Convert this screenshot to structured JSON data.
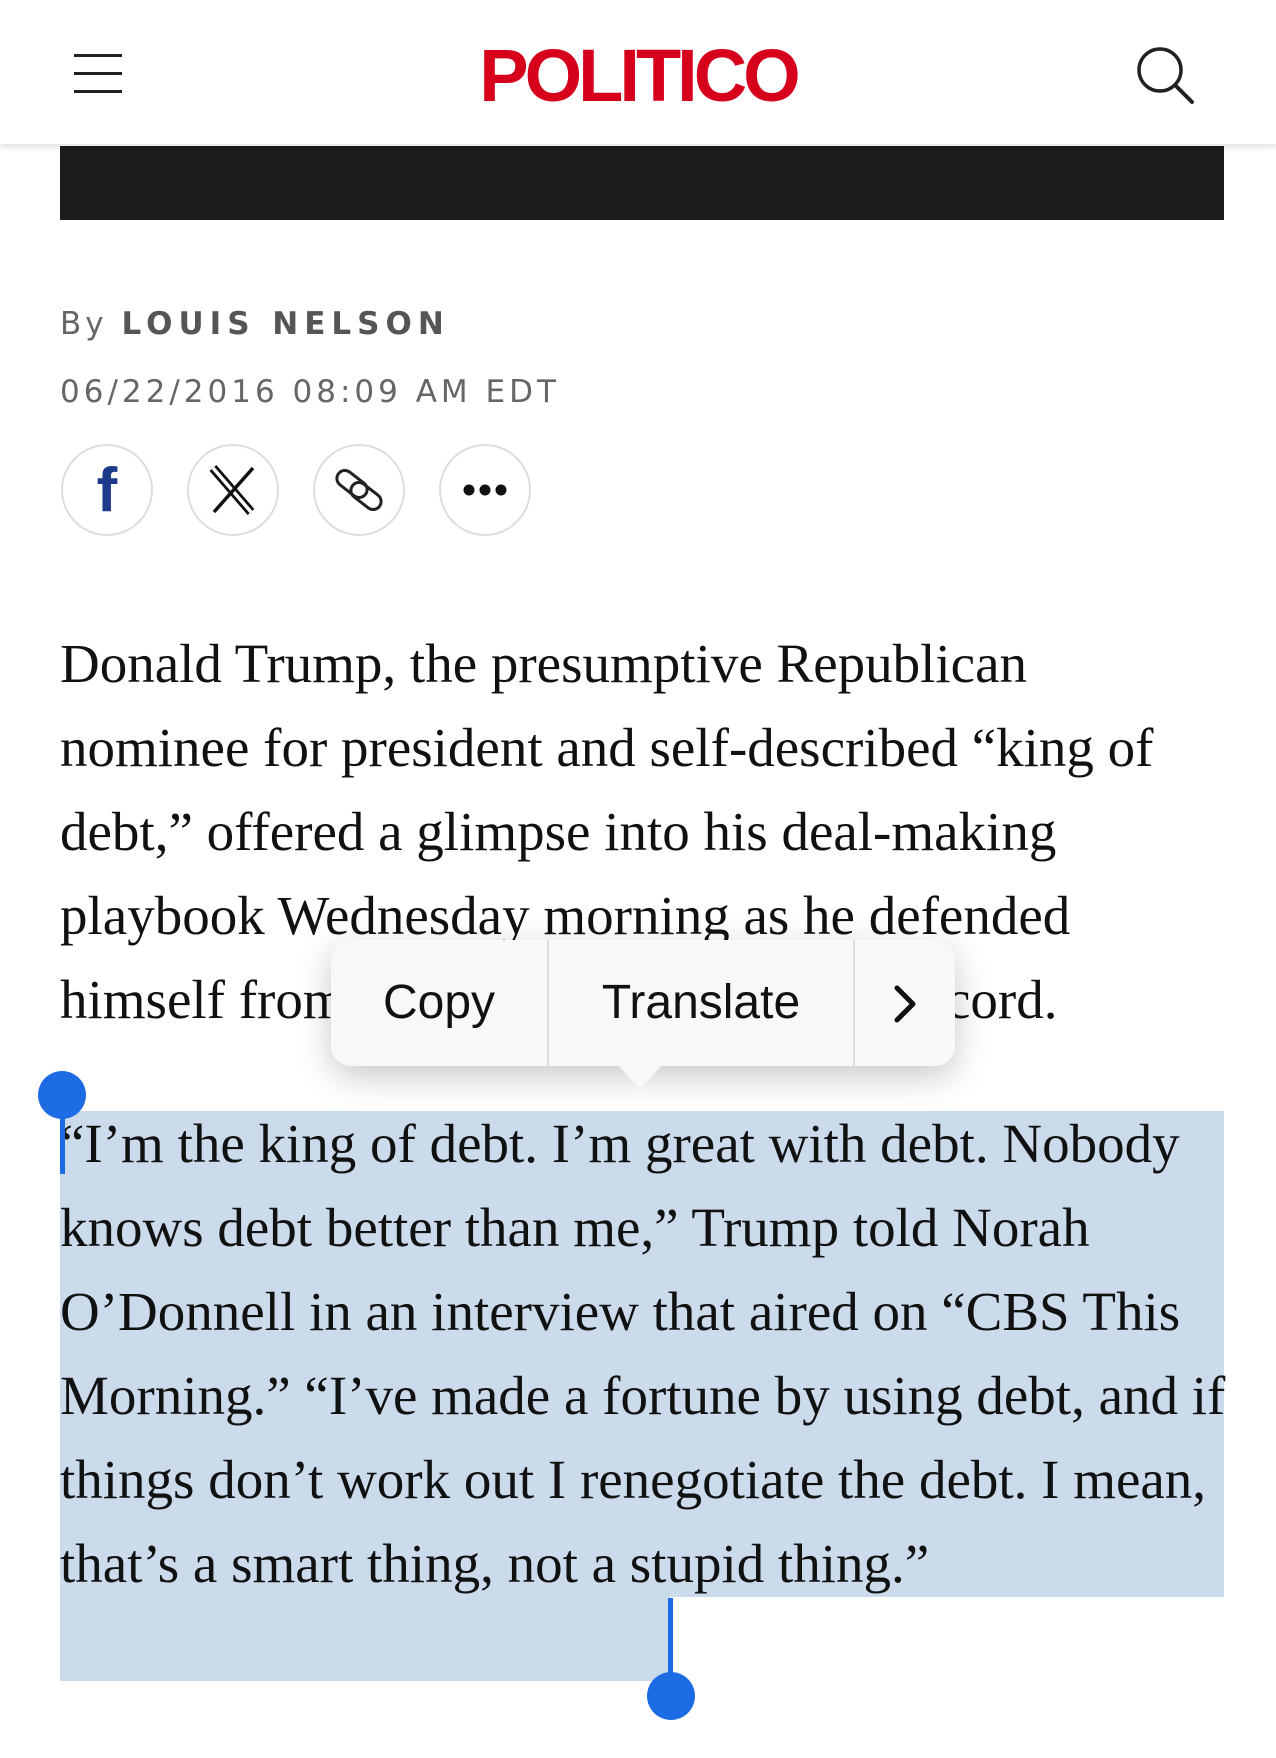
{
  "header": {
    "logo": "POLITICO",
    "menu_icon": "hamburger-menu-icon",
    "search_icon": "search-icon",
    "logo_color": "#d6001c"
  },
  "byline": {
    "prefix": "By",
    "author": "LOUIS NELSON",
    "timestamp": "06/22/2016 08:09 AM EDT"
  },
  "share": {
    "facebook": "f",
    "icons": [
      "facebook-icon",
      "x-icon",
      "link-icon",
      "more-icon"
    ]
  },
  "article": {
    "paragraph1": "Donald Trump, the presumptive Republican nominee for president and self-described “king of debt,” offered a glimpse into his deal-making playbook Wednesday morning as he defended himself from criticism of his business record.",
    "paragraph2": "“I’m the king of debt. I’m great with debt. Nobody knows debt better than me,” Trump told Norah O’Donnell in an interview that aired on “CBS This Morning.” “I’ve made a fortune by using debt, and if things don’t work out I renegotiate the debt. I mean, that’s a smart thing, not a stupid thing.”"
  },
  "context_menu": {
    "copy": "Copy",
    "translate": "Translate",
    "more_icon": "chevron-right-icon"
  },
  "colors": {
    "selection": "#cbdbec",
    "selection_handle": "#1d6ce4"
  }
}
